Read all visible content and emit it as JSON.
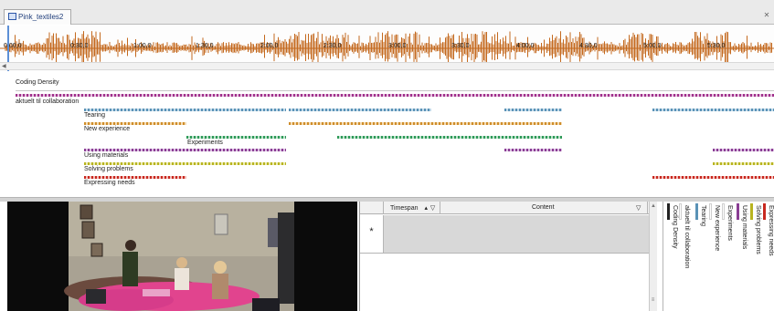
{
  "tab": {
    "title": "Pink_textiles2",
    "close": "✕"
  },
  "timeline": {
    "time_labels": [
      "0:00,0",
      "0:30,0",
      "1:00,0",
      "1:30,0",
      "2:00,0",
      "2:30,0",
      "3:00,0",
      "3:30,0",
      "4:00,0",
      "4:30,0",
      "5:00,0",
      "5:30,0"
    ]
  },
  "coding": {
    "density_label": "Coding Density",
    "rows": [
      {
        "key": "colab",
        "label": "aktuelt til collaboration"
      },
      {
        "key": "tear",
        "label": "Tearing"
      },
      {
        "key": "newx",
        "label": "New experience"
      },
      {
        "key": "exp",
        "label": "Experiments"
      },
      {
        "key": "using",
        "label": "Using materials"
      },
      {
        "key": "solve",
        "label": "Solving problems"
      },
      {
        "key": "expr",
        "label": "Expressing needs"
      }
    ]
  },
  "transcript": {
    "columns": {
      "timespan": "Timespan",
      "content": "Content"
    },
    "new_row_marker": "*",
    "sort_icon": "▴",
    "filter_icon": "▽"
  },
  "stripes_panel": {
    "items": [
      {
        "label": "Coding Density",
        "color": "#222222"
      },
      {
        "label": "aktuelt til collaboration",
        "color": "#ffffff"
      },
      {
        "label": "Tearing",
        "color": "#5a92b6"
      },
      {
        "label": "New experience",
        "color": "#ffffff"
      },
      {
        "label": "Experiments",
        "color": "#ffffff"
      },
      {
        "label": "Using materials",
        "color": "#8a3d94"
      },
      {
        "label": "Solving problems",
        "color": "#b8b420"
      },
      {
        "label": "Expressing needs",
        "color": "#c8281f"
      }
    ]
  },
  "colors": {
    "waveform": "#c4691e",
    "accent": "#5c8fd6"
  }
}
